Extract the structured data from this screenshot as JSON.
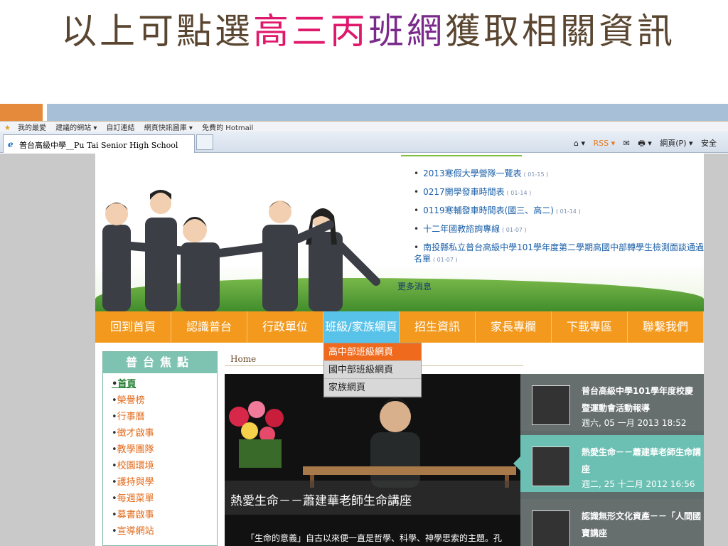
{
  "slide": {
    "title_part1": "以上可點選",
    "title_hl1": "高三丙",
    "title_hl2": "班網",
    "title_part2": "獲取相關資訊"
  },
  "browser": {
    "favorites": [
      "我的最愛",
      "建議的網站 ▾",
      "自訂連結",
      "網頁快訊圖庫 ▾",
      "免費的 Hotmail"
    ],
    "tab_title": "普台高級中學__Pu Tai Senior High School",
    "commands": [
      "⌂ ▾",
      "RSS ▾",
      "✉",
      "🖶 ▾",
      "網頁(P) ▾",
      "安全"
    ]
  },
  "site": {
    "news": [
      {
        "text": "2013寒假大學營隊一覽表",
        "date": "( 01-15 )"
      },
      {
        "text": "0217開學發車時間表",
        "date": "( 01-14 )"
      },
      {
        "text": "0119寒輔發車時間表(國三、高二)",
        "date": "( 01-14 )"
      },
      {
        "text": "十二年國教諮詢專線",
        "date": "( 01-07 )"
      },
      {
        "text": "南投縣私立普台高級中學101學年度第二學期高國中部轉學生檢測面談通過名單",
        "date": "( 01-07 )"
      }
    ],
    "more_news": "更多消息",
    "nav": [
      "回到首頁",
      "認識普台",
      "行政單位",
      "班級/家族網頁",
      "招生資訊",
      "家長專欄",
      "下載專區",
      "聯繫我們"
    ],
    "dropdown": [
      "高中部班級網頁",
      "國中部班級網頁",
      "家族網頁"
    ],
    "sidebar_title": "普台焦點",
    "sidebar_items": [
      "首頁",
      "榮譽榜",
      "行事曆",
      "徵才啟事",
      "教學團隊",
      "校園環境",
      "護持與學",
      "每週菜單",
      "募書啟事",
      "宣導網站"
    ],
    "breadcrumb": "Home",
    "feature_caption": "熱愛生命－－蕭建華老師生命講座",
    "feature_sub": "「生命的意義」自古以來便一直是哲學、科學、神學思索的主題。孔",
    "cards": [
      {
        "title": "普台高級中學101學年度校慶暨運動會活動報導",
        "date": "週六, 05 一月 2013 18:52"
      },
      {
        "title": "熱愛生命－－蕭建華老師生命講座",
        "date": "週二, 25 十二月 2012 16:56"
      },
      {
        "title": "認識無形文化資產－－「人間國寶講座",
        "date": ""
      }
    ]
  }
}
